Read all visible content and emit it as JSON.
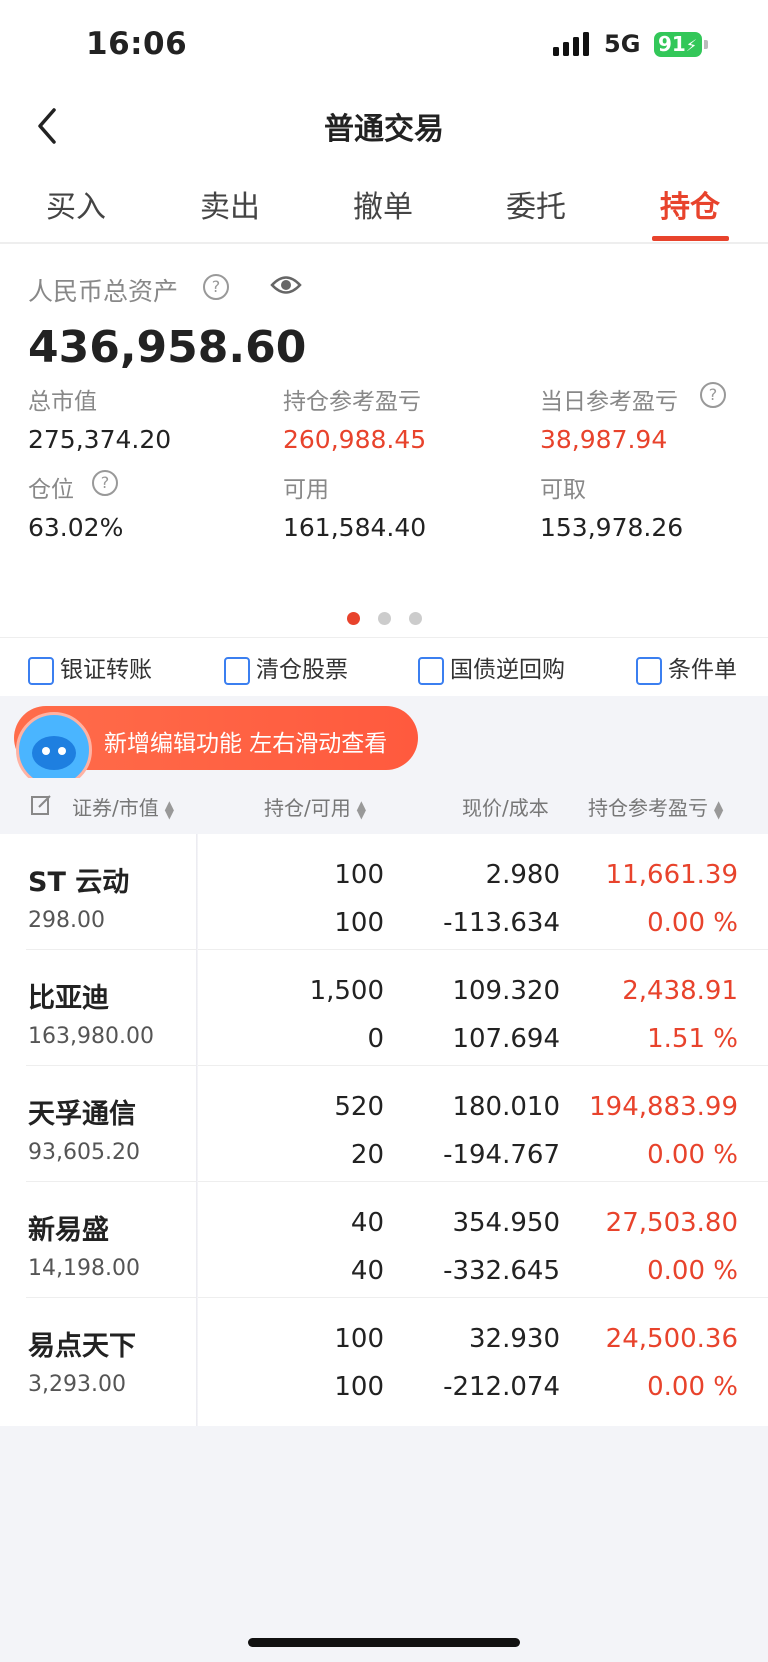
{
  "status": {
    "time": "16:06",
    "network": "5G",
    "battery": "91"
  },
  "nav": {
    "title": "普通交易"
  },
  "tabs": [
    "买入",
    "卖出",
    "撤单",
    "委托",
    "持仓"
  ],
  "active_tab": "持仓",
  "summary": {
    "assets_label": "人民币总资产",
    "assets_value": "436,958.60",
    "metrics": [
      {
        "label": "总市值",
        "value": "275,374.20"
      },
      {
        "label": "持仓参考盈亏",
        "value": "260,988.45"
      },
      {
        "label": "当日参考盈亏",
        "value": "38,987.94"
      },
      {
        "label": "仓位",
        "value": "63.02%"
      },
      {
        "label": "可用",
        "value": "161,584.40"
      },
      {
        "label": "可取",
        "value": "153,978.26"
      }
    ]
  },
  "shortcuts": [
    "银证转账",
    "清仓股票",
    "国债逆回购",
    "条件单"
  ],
  "banner": {
    "text": "新增编辑功能 左右滑动查看"
  },
  "table": {
    "headers": [
      "证券/市值",
      "持仓/可用",
      "现价/成本",
      "持仓参考盈亏"
    ],
    "rows": [
      {
        "name": "ST 云动",
        "market_value": "298.00",
        "holding": "100",
        "available": "100",
        "price": "2.980",
        "cost": "-113.634",
        "pnl": "11,661.39",
        "pnl_pct": "0.00 %"
      },
      {
        "name": "比亚迪",
        "market_value": "163,980.00",
        "holding": "1,500",
        "available": "0",
        "price": "109.320",
        "cost": "107.694",
        "pnl": "2,438.91",
        "pnl_pct": "1.51 %"
      },
      {
        "name": "天孚通信",
        "market_value": "93,605.20",
        "holding": "520",
        "available": "20",
        "price": "180.010",
        "cost": "-194.767",
        "pnl": "194,883.99",
        "pnl_pct": "0.00 %"
      },
      {
        "name": "新易盛",
        "market_value": "14,198.00",
        "holding": "40",
        "available": "40",
        "price": "354.950",
        "cost": "-332.645",
        "pnl": "27,503.80",
        "pnl_pct": "0.00 %"
      },
      {
        "name": "易点天下",
        "market_value": "3,293.00",
        "holding": "100",
        "available": "100",
        "price": "32.930",
        "cost": "-212.074",
        "pnl": "24,500.36",
        "pnl_pct": "0.00 %"
      }
    ]
  },
  "colors": {
    "accent": "#e8432c",
    "icon_blue": "#3b7ff0"
  }
}
